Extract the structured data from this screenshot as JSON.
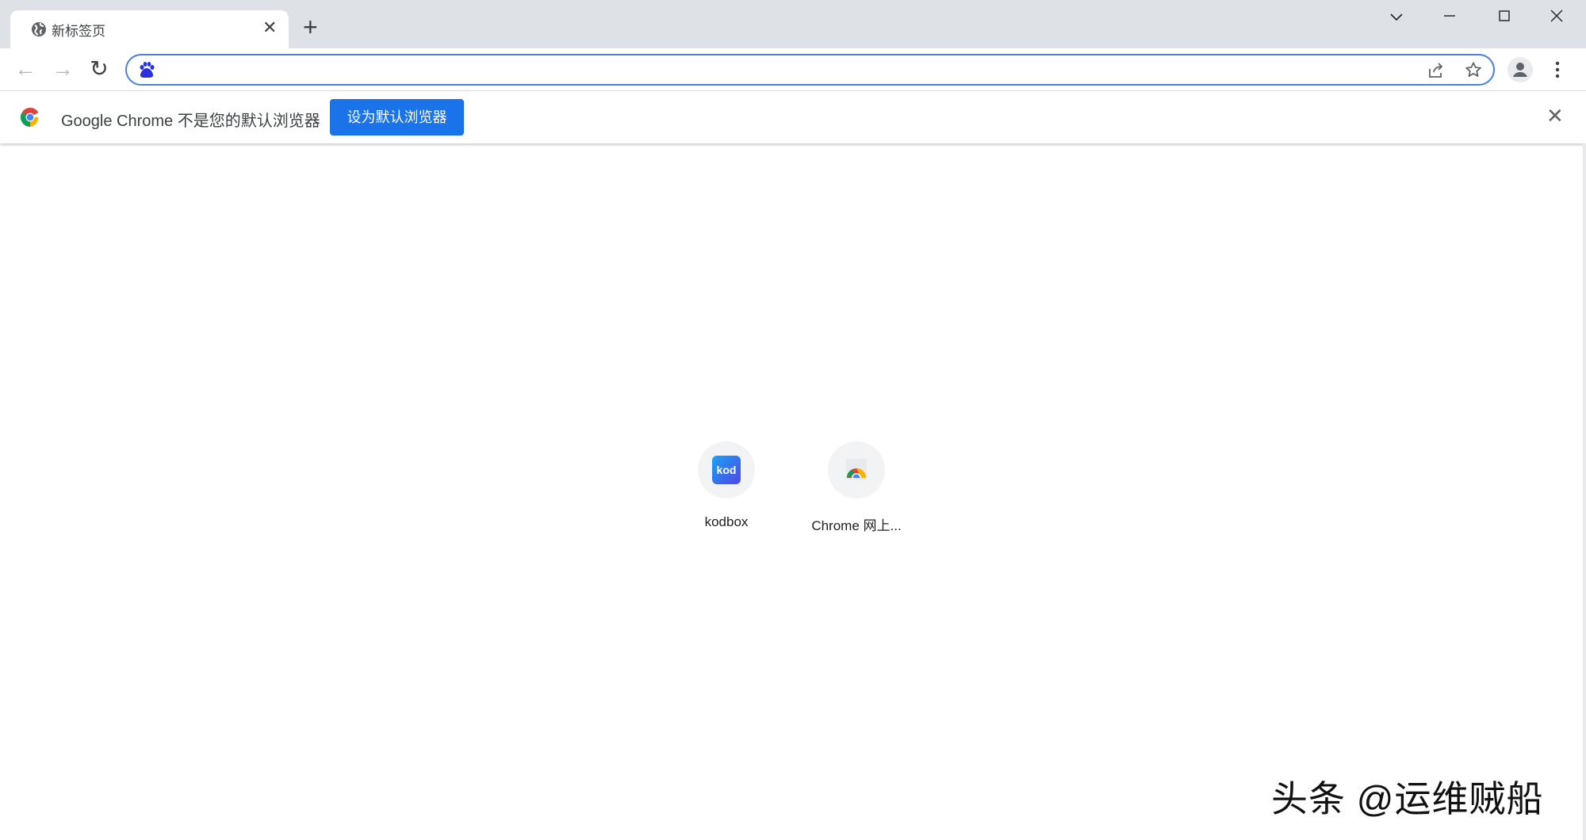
{
  "tab": {
    "title": "新标签页",
    "icon": "globe-icon"
  },
  "window_controls": {
    "tab_search": "⌵",
    "minimize": "—",
    "maximize": "☐",
    "close": "✕"
  },
  "toolbar": {
    "omnibox_value": "",
    "search_engine_icon": "baidu-paw-icon"
  },
  "infobar": {
    "message": "Google Chrome 不是您的默认浏览器",
    "button": "设为默认浏览器"
  },
  "shortcuts": [
    {
      "label": "kodbox",
      "icon_text": "kod"
    },
    {
      "label": "Chrome 网上..."
    }
  ],
  "watermark": "头条 @运维贼船",
  "colors": {
    "accent": "#1a73e8",
    "tabstrip": "#dee1e6",
    "omnibox_border": "#4a7fde"
  }
}
